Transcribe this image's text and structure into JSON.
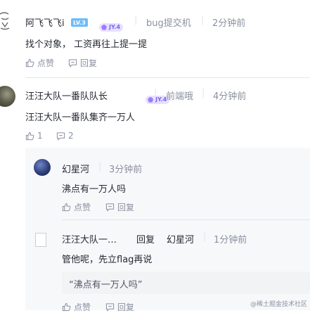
{
  "comments": [
    {
      "author": "阿飞飞飞i",
      "level_badge": "LV.3",
      "jy_badge": "JY.4",
      "position": "bug提交机",
      "time": "2分钟前",
      "content": "找个对象， 工资再往上提一提",
      "like_label": "点赞",
      "reply_label": "回复"
    },
    {
      "author": "汪汪大队一番队队长",
      "jy_badge": "JY.4",
      "position": "前端哦",
      "time": "4分钟前",
      "content": "汪汪大队一番队集齐一万人",
      "like_count": "1",
      "reply_count": "2",
      "replies": [
        {
          "author": "幻星河",
          "time": "3分钟前",
          "content": "沸点有一万人吗",
          "like_label": "点赞",
          "reply_label": "回复"
        },
        {
          "author": "汪汪大队一…",
          "reply_word": "回复",
          "reply_to": "幻星河",
          "time": "1分钟前",
          "content": "管他呢，先立flag再说",
          "quote": "“沸点有一万人吗”",
          "like_label": "点赞",
          "reply_label": "回复"
        }
      ]
    }
  ],
  "watermark": "@稀土掘金技术社区",
  "colors": {
    "text": "#252933",
    "meta": "#8a919f",
    "divider": "#e4e6eb",
    "panel": "#f7f8fa",
    "quote_bg": "#f2f3f5"
  }
}
